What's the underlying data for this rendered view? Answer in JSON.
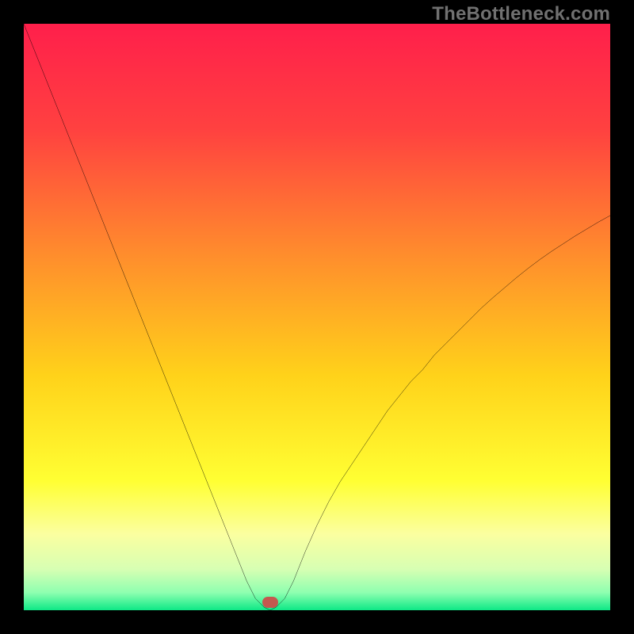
{
  "watermark": "TheBottleneck.com",
  "marker": {
    "x_percent": 42,
    "y_percent": 98.6,
    "color": "#c4584f"
  },
  "gradient_stops": [
    {
      "pct": 0,
      "color": "#ff1f4b"
    },
    {
      "pct": 18,
      "color": "#ff4140"
    },
    {
      "pct": 40,
      "color": "#ff8f2c"
    },
    {
      "pct": 60,
      "color": "#ffd21a"
    },
    {
      "pct": 78,
      "color": "#ffff33"
    },
    {
      "pct": 87,
      "color": "#fbffa0"
    },
    {
      "pct": 93,
      "color": "#d7ffb3"
    },
    {
      "pct": 97,
      "color": "#8effb0"
    },
    {
      "pct": 100,
      "color": "#0de886"
    }
  ],
  "chart_data": {
    "type": "line",
    "title": "",
    "xlabel": "",
    "ylabel": "",
    "xlim": [
      0,
      100
    ],
    "ylim": [
      0,
      100
    ],
    "x": [
      0,
      2,
      4,
      6,
      8,
      10,
      12,
      14,
      16,
      18,
      20,
      22,
      24,
      26,
      28,
      30,
      32,
      34,
      36,
      38,
      39.5,
      41,
      42,
      43,
      44.5,
      46,
      48,
      50,
      52,
      54,
      56,
      58,
      60,
      62,
      64,
      66,
      68,
      70,
      72,
      74,
      76,
      78,
      80,
      82,
      84,
      86,
      88,
      90,
      92,
      94,
      96,
      98,
      100
    ],
    "series": [
      {
        "name": "bottleneck-curve",
        "values": [
          100,
          95,
          90,
          85,
          80,
          75,
          70,
          65,
          60,
          55,
          50,
          45,
          40,
          35,
          30,
          25,
          20,
          15,
          10,
          5,
          2,
          0.5,
          0,
          0.5,
          2,
          5,
          10,
          14.5,
          18.5,
          22,
          25,
          28,
          31,
          34,
          36.5,
          39,
          41,
          43.5,
          45.5,
          47.5,
          49.5,
          51.5,
          53.3,
          55,
          56.7,
          58.3,
          59.8,
          61.2,
          62.5,
          63.8,
          65,
          66.2,
          67.3
        ]
      }
    ],
    "annotations": [
      {
        "type": "marker",
        "x": 42,
        "y": 1.4,
        "label": "optimal-point"
      }
    ]
  }
}
